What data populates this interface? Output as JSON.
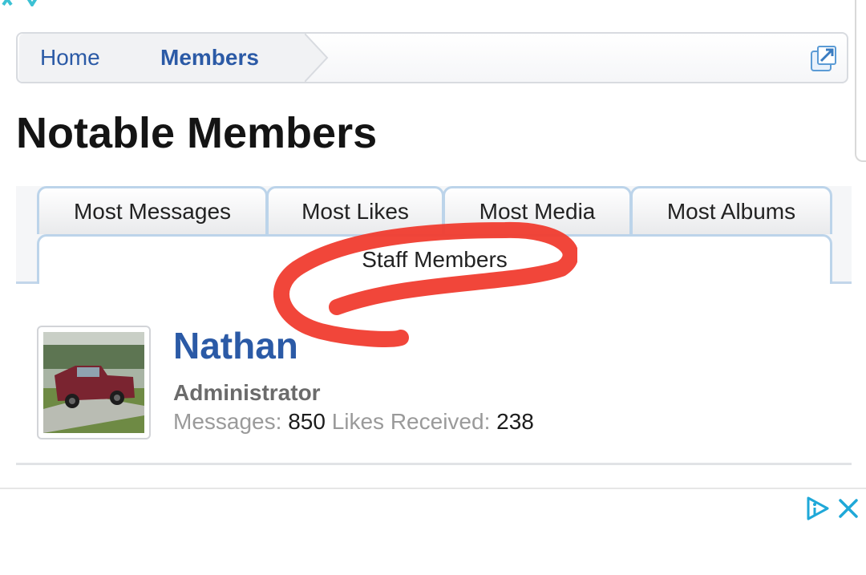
{
  "breadcrumb": {
    "items": [
      "Home",
      "Members"
    ]
  },
  "page": {
    "title": "Notable Members"
  },
  "tabs": {
    "items": [
      "Most Messages",
      "Most Likes",
      "Most Media",
      "Most Albums"
    ],
    "active": "Staff Members"
  },
  "member": {
    "name": "Nathan",
    "role": "Administrator",
    "messages_label": "Messages:",
    "messages_value": "850",
    "likes_label": "Likes Received:",
    "likes_value": "238"
  },
  "colors": {
    "link_blue": "#2b5aa6",
    "tab_border": "#bcd4ea",
    "annotation_red": "#f03c2f",
    "ad_icon_teal": "#1fa8d8"
  },
  "icons": {
    "breadcrumb_action": "external-link-icon",
    "ad_info": "ad-choices-icon",
    "ad_close": "close-icon"
  }
}
